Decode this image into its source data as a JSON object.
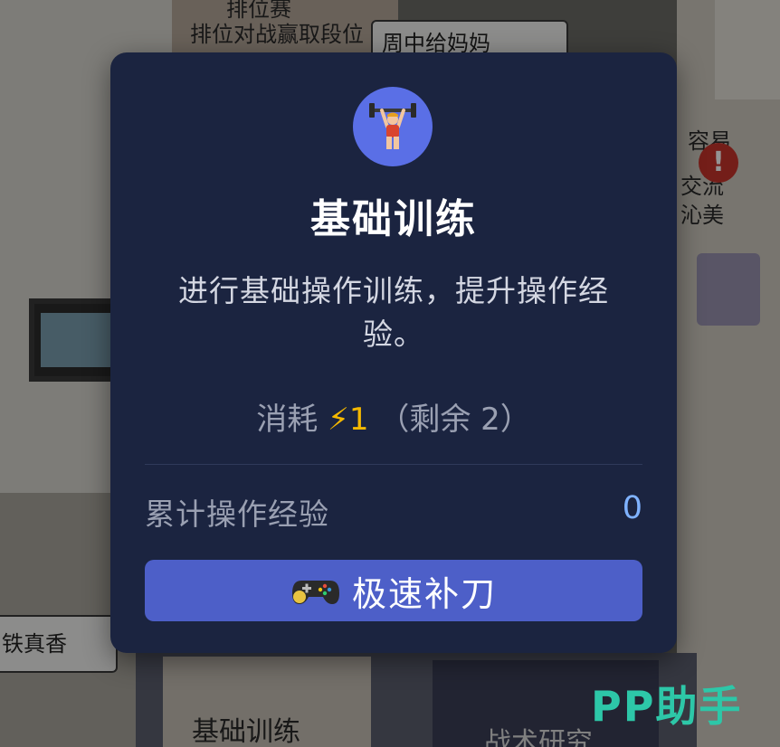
{
  "background": {
    "top_banner_line1": "排位赛",
    "top_banner_line2": "排位对战赢取段位",
    "top_right_card": "周中给妈妈",
    "right_card_top": "容易",
    "right_card_mid": "交流",
    "right_card_bottom": "沁美",
    "left_card": "铁真香",
    "bottom_tile_left": "基础训练",
    "bottom_tile_right": "战术研究",
    "alert_mark": "!"
  },
  "modal": {
    "icon_name": "weightlifter-icon",
    "title": "基础训练",
    "description": "进行基础操作训练，提升操作经验。",
    "cost_label": "消耗",
    "cost_icon": "⚡",
    "cost_value": "1",
    "remaining_text": "（剩余 2）",
    "stat_label": "累计操作经验",
    "stat_value": "0",
    "action_icon": "gamepad-icon",
    "action_label": "极速补刀"
  },
  "watermark": "PP助手",
  "colors": {
    "modal_bg": "#1b2440",
    "icon_circle": "#5a6fe6",
    "button_bg": "#4d5fc8",
    "stat_value": "#7fb2ff",
    "energy": "#f5b800",
    "watermark": "#2dc7a8"
  }
}
